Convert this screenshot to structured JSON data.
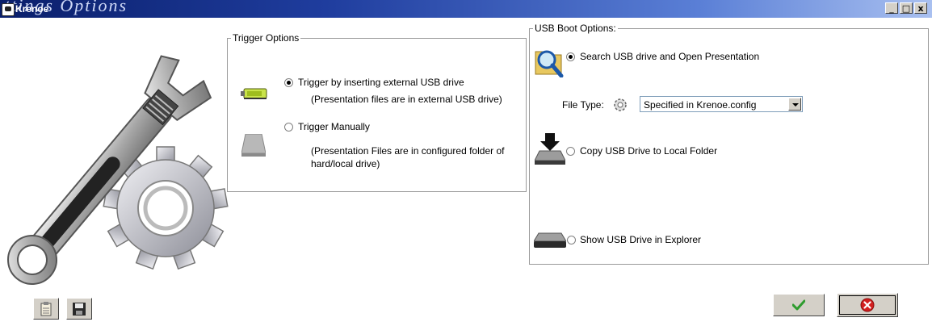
{
  "window": {
    "title": "Krenoe",
    "title_overlay_text": "ttings Options",
    "minimize_glyph": "_",
    "maximize_glyph": "□",
    "close_glyph": "x"
  },
  "trigger_options": {
    "legend": "Trigger Options",
    "usb": {
      "label": "Trigger by inserting external USB drive",
      "description": "(Presentation files are in external USB drive)",
      "selected": true
    },
    "manual": {
      "label": "Trigger Manually",
      "description_line1": "(Presentation Files are in configured folder of",
      "description_line2": "hard/local drive)",
      "selected": false
    }
  },
  "usb_boot_options": {
    "legend": "USB Boot Options:",
    "search": {
      "label": "Search USB drive and Open Presentation",
      "selected": true
    },
    "file_type": {
      "label": "File Type:",
      "selected_value": "Specified in Krenoe.config"
    },
    "copy": {
      "label": "Copy USB Drive to Local Folder",
      "selected": false
    },
    "show": {
      "label": "Show USB Drive in Explorer",
      "selected": false
    }
  },
  "icons": {
    "app": "krenoe-app-icon",
    "illustration": "wrench-gear-icon",
    "usb_trigger": "usb-stick-icon",
    "manual_trigger": "hard-drive-icon",
    "search": "magnifier-folder-icon",
    "file_type": "gear-file-icon",
    "copy": "copy-drive-icon",
    "show": "drive-explorer-icon",
    "clear": "clipboard-icon",
    "save": "floppy-disk-icon",
    "ok": "checkmark-icon",
    "cancel": "cancel-x-icon"
  },
  "colors": {
    "titlebar_start": "#0a1f6b",
    "titlebar_end": "#a9c0f0",
    "ok_green": "#2e9c2e",
    "cancel_red": "#d21f1f"
  }
}
